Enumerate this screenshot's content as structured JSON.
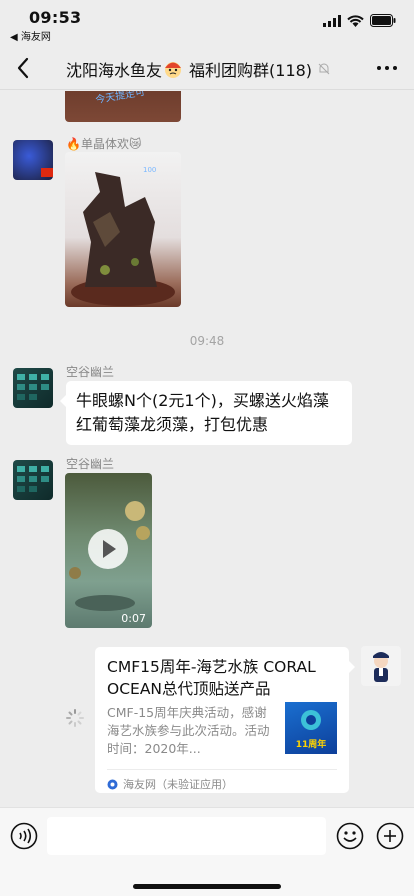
{
  "status_bar": {
    "time": "09:53",
    "back_app": "◀ 海友网"
  },
  "nav": {
    "title_prefix": "沈阳海水鱼友",
    "title_suffix": "福利团购群(118)"
  },
  "messages": {
    "msg1": {
      "sender": "🔥单晶体欢😿",
      "image_caption": "今天提走可"
    },
    "time_divider": "09:48",
    "msg2": {
      "sender": "空谷幽兰",
      "text": "牛眼螺N个(2元1个)，买螺送火焰藻红葡萄藻龙须藻，打包优惠"
    },
    "msg3": {
      "sender": "空谷幽兰",
      "video_duration": "0:07"
    },
    "msg4": {
      "card_title": "CMF15周年-海艺水族 CORAL OCEAN总代顶贴送产品",
      "card_desc": "CMF-15周年庆典活动，感谢海艺水族参与此次活动。活动时间：2020年...",
      "thumb_label": "11周年",
      "source": "海友网（未验证应用）"
    }
  },
  "icons": {
    "back": "chevron-left-icon",
    "more": "more-dots-icon",
    "voice": "voice-icon",
    "emoji": "emoji-icon",
    "plus": "plus-icon"
  },
  "colors": {
    "background": "#ededed",
    "bubble": "#ffffff",
    "secondary_text": "#888888"
  }
}
